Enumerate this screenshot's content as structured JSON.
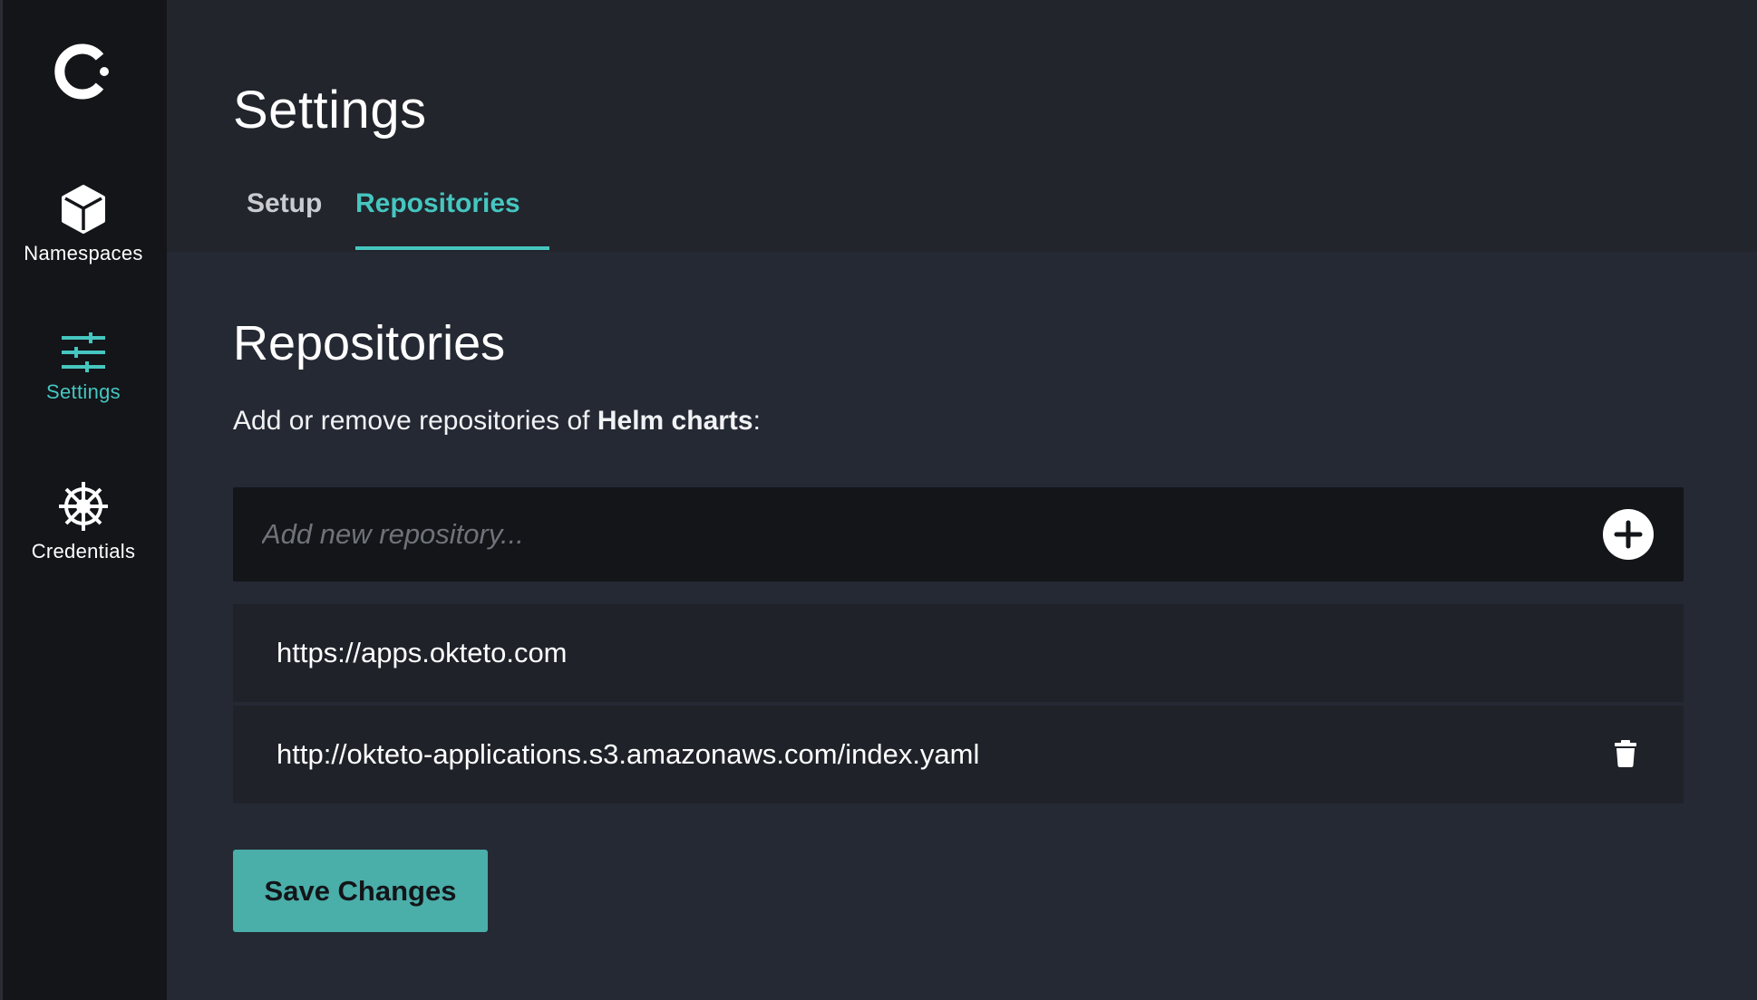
{
  "sidebar": {
    "logo_icon": "okteto-logo-icon",
    "items": [
      {
        "label": "Namespaces",
        "icon": "cube-icon",
        "active": false
      },
      {
        "label": "Settings",
        "icon": "sliders-icon",
        "active": true
      },
      {
        "label": "Credentials",
        "icon": "helm-wheel-icon",
        "active": false
      }
    ]
  },
  "header": {
    "title": "Settings",
    "tabs": [
      {
        "label": "Setup",
        "active": false
      },
      {
        "label": "Repositories",
        "active": true
      }
    ]
  },
  "main": {
    "section_title": "Repositories",
    "description_prefix": "Add or remove repositories of ",
    "description_bold": "Helm charts",
    "description_suffix": ":",
    "add_input": {
      "value": "",
      "placeholder": "Add new repository..."
    },
    "add_button_icon": "plus-circle-icon",
    "repositories": [
      {
        "url": "https://apps.okteto.com",
        "deletable": false
      },
      {
        "url": "http://okteto-applications.s3.amazonaws.com/index.yaml",
        "deletable": true
      }
    ],
    "delete_icon": "trash-icon",
    "save_label": "Save Changes"
  },
  "colors": {
    "accent": "#46c6c0",
    "button": "#4aaea9",
    "background": "#252934",
    "sidebar": "#131519"
  }
}
